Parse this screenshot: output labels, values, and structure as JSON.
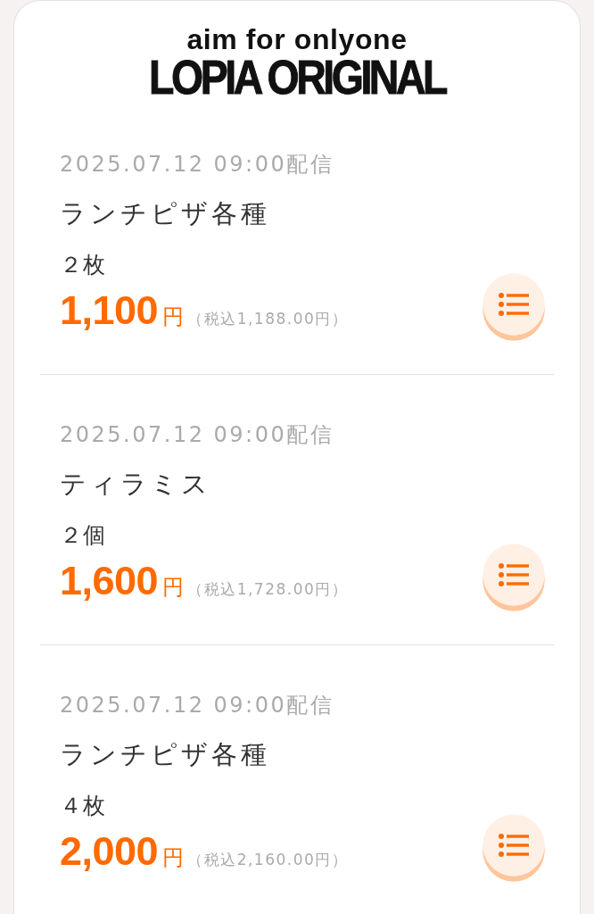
{
  "logo": {
    "tagline": "aim for onlyone",
    "wordmark": "LOPIA ORIGINAL"
  },
  "items": [
    {
      "date": "2025.07.12 09:00配信",
      "title": "ランチピザ各種",
      "quantity": "２枚",
      "price": "1,100",
      "currency": "円",
      "tax_included": "（税込1,188.00円）"
    },
    {
      "date": "2025.07.12 09:00配信",
      "title": "ティラミス",
      "quantity": "２個",
      "price": "1,600",
      "currency": "円",
      "tax_included": "（税込1,728.00円）"
    },
    {
      "date": "2025.07.12 09:00配信",
      "title": "ランチピザ各種",
      "quantity": "４枚",
      "price": "2,000",
      "currency": "円",
      "tax_included": "（税込2,160.00円）"
    }
  ]
}
